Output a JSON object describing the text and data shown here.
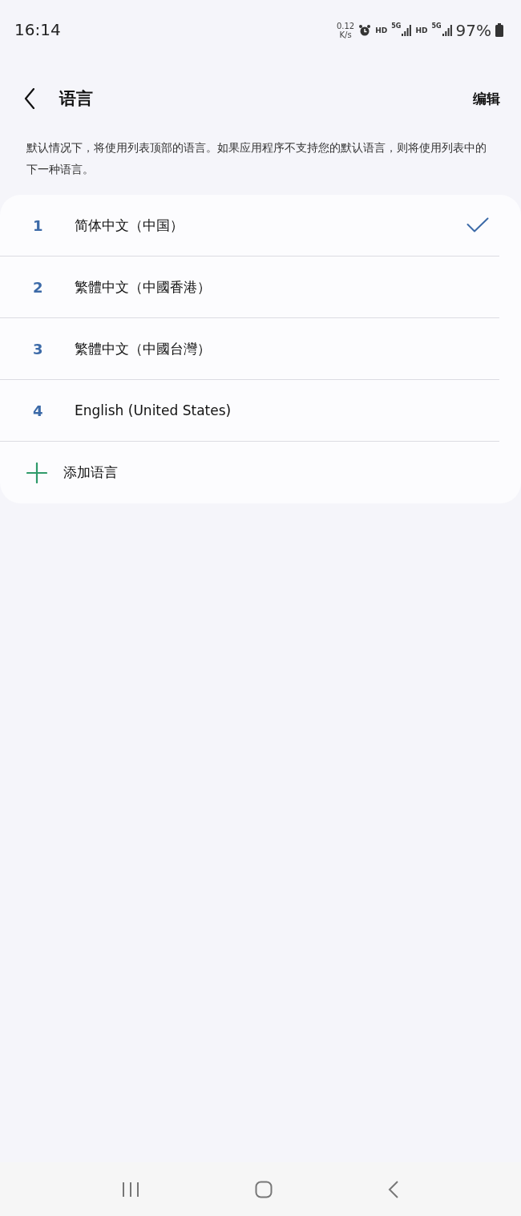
{
  "status_bar": {
    "time": "16:14",
    "speed": "0.12",
    "speed_unit": "K/s",
    "hd_1": "HD",
    "net_1": "5G",
    "hd_2": "HD",
    "net_2": "5G",
    "battery": "97%"
  },
  "header": {
    "title": "语言",
    "action": "编辑"
  },
  "description": "默认情况下，将使用列表顶部的语言。如果应用程序不支持您的默认语言，则将使用列表中的下一种语言。",
  "languages": [
    {
      "number": "1",
      "name": "简体中文（中国）",
      "selected": true
    },
    {
      "number": "2",
      "name": "繁體中文（中國香港）",
      "selected": false
    },
    {
      "number": "3",
      "name": "繁體中文（中國台灣）",
      "selected": false
    },
    {
      "number": "4",
      "name": "English (United States)",
      "selected": false
    }
  ],
  "add_language": "添加语言"
}
